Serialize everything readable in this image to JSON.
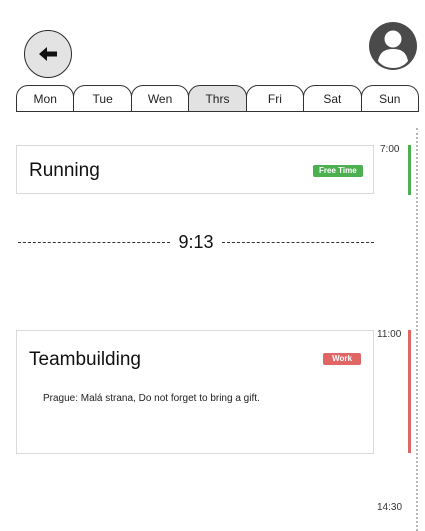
{
  "header": {
    "back_icon": "arrow-left-icon",
    "profile_icon": "user-avatar-icon"
  },
  "days": [
    {
      "label": "Mon",
      "active": false
    },
    {
      "label": "Tue",
      "active": false
    },
    {
      "label": "Wen",
      "active": false
    },
    {
      "label": "Thrs",
      "active": true
    },
    {
      "label": "Fri",
      "active": false
    },
    {
      "label": "Sat",
      "active": false
    },
    {
      "label": "Sun",
      "active": false
    }
  ],
  "current_time": "9:13",
  "events": [
    {
      "title": "Running",
      "tag": "Free Time",
      "tag_color": "#4caf50",
      "description": "",
      "start": "7:00"
    },
    {
      "title": "Teambuilding",
      "tag": "Work",
      "tag_color": "#e06666",
      "description": "Prague: Malá strana, Do not forget to bring a gift.",
      "start": "11:00"
    }
  ],
  "timeline": {
    "labels": [
      "7:00",
      "11:00",
      "14:30"
    ]
  },
  "colors": {
    "free_time": "#4caf50",
    "work": "#e06666",
    "active_day": "#e2e2e2"
  }
}
